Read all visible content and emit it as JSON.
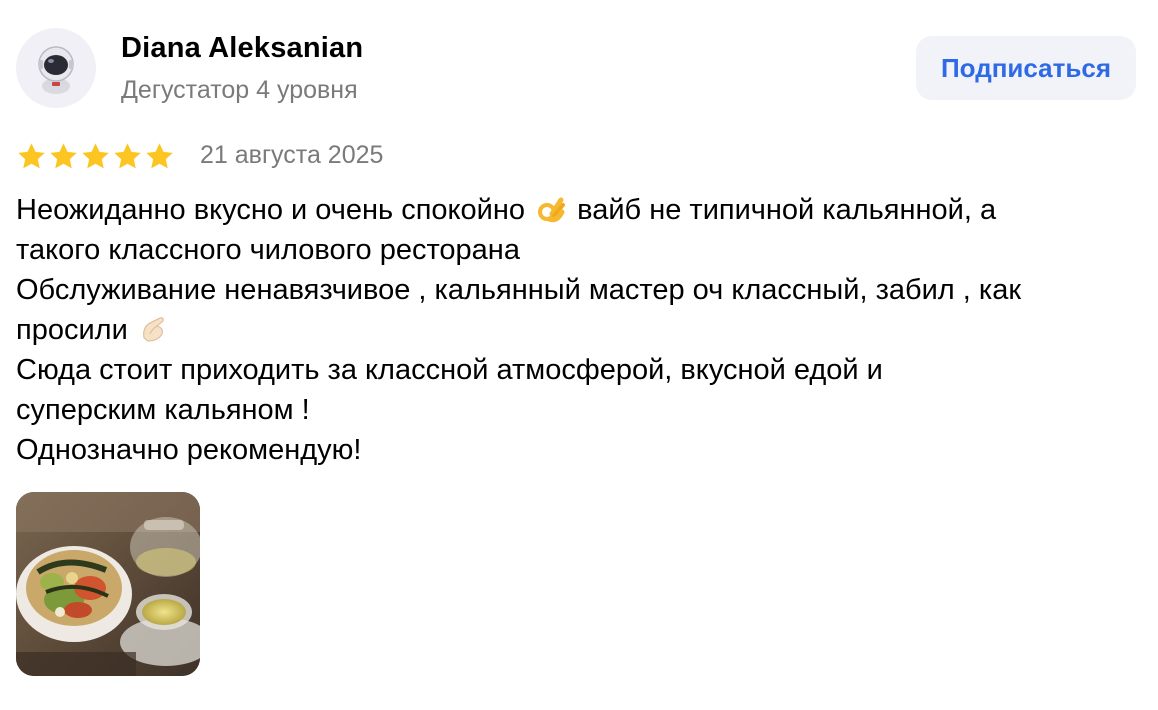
{
  "author": {
    "name": "Diana Aleksanian",
    "level": "Дегустатор 4 уровня",
    "avatar_icon": "astronaut-icon"
  },
  "subscribe": {
    "label": "Подписаться"
  },
  "review": {
    "rating": 5,
    "rating_max": 5,
    "star_color": "#fcc521",
    "date": "21 августа 2025",
    "lines": {
      "l1a": "Неожиданно вкусно и очень спокойно",
      "l1b": " вайб не типичной кальянной, а",
      "l2": "такого классного чилового ресторана",
      "l3": "Обслуживание ненавязчивое , кальянный мастер оч классный, забил , как",
      "l4": "просили",
      "l5": "Сюда стоит приходить за классной атмосферой, вкусной едой и",
      "l6": "суперским кальяном !",
      "l7": "Однозначно рекомендую!"
    },
    "emojis": [
      "ok-hand-icon",
      "pinching-hand-icon"
    ]
  },
  "photo": {
    "icon": "food-photo"
  },
  "colors": {
    "accent": "#2f6ae6",
    "muted_text": "#7a7a7a",
    "button_bg": "#f2f3f8"
  }
}
